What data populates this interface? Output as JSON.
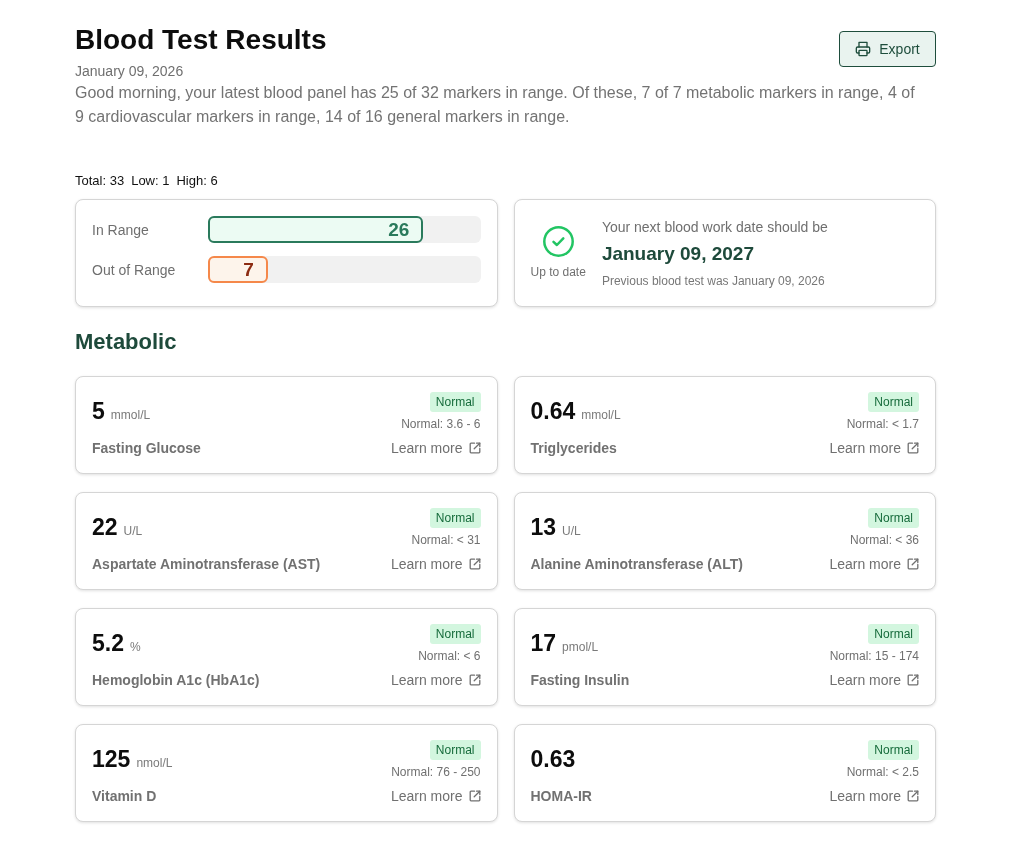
{
  "header": {
    "title": "Blood Test Results",
    "date": "January 09, 2026",
    "summary": "Good morning, your latest blood panel has 25 of 32 markers in range. Of these, 7 of 7 metabolic markers in range, 4 of 9 cardiovascular markers in range, 14 of 16 general markers in range.",
    "export_label": "Export"
  },
  "counts": [
    "Total: 33",
    "Low: 1",
    "High: 6"
  ],
  "range_summary": {
    "bars": [
      {
        "kind": "in",
        "label": "In Range",
        "count": "26",
        "level": 0.79
      },
      {
        "kind": "out",
        "label": "Out of Range",
        "count": "7",
        "level": 0.22
      }
    ]
  },
  "schedule": {
    "status": "Up to date",
    "heading": "Your next blood work date should be",
    "next_date": "January 09, 2027",
    "previous": "Previous blood test was January 09, 2026"
  },
  "sections": [
    {
      "title": "Metabolic",
      "markers": [
        {
          "value": "5",
          "unit": "mmol/L",
          "name": "Fasting Glucose",
          "status": "Normal",
          "range": "Normal: 3.6 - 6",
          "link": "Learn more"
        },
        {
          "value": "0.64",
          "unit": "mmol/L",
          "name": "Triglycerides",
          "status": "Normal",
          "range": "Normal: < 1.7",
          "link": "Learn more"
        },
        {
          "value": "22",
          "unit": "U/L",
          "name": "Aspartate Aminotransferase (AST)",
          "status": "Normal",
          "range": "Normal: < 31",
          "link": "Learn more"
        },
        {
          "value": "13",
          "unit": "U/L",
          "name": "Alanine Aminotransferase (ALT)",
          "status": "Normal",
          "range": "Normal: < 36",
          "link": "Learn more"
        },
        {
          "value": "5.2",
          "unit": "%",
          "name": "Hemoglobin A1c (HbA1c)",
          "status": "Normal",
          "range": "Normal: < 6",
          "link": "Learn more"
        },
        {
          "value": "17",
          "unit": "pmol/L",
          "name": "Fasting Insulin",
          "status": "Normal",
          "range": "Normal: 15 - 174",
          "link": "Learn more"
        },
        {
          "value": "125",
          "unit": "nmol/L",
          "name": "Vitamin D",
          "status": "Normal",
          "range": "Normal: 76 - 250",
          "link": "Learn more"
        },
        {
          "value": "0.63",
          "name": "HOMA-IR",
          "status": "Normal",
          "range": "Normal: < 2.5",
          "link": "Learn more"
        }
      ]
    }
  ]
}
